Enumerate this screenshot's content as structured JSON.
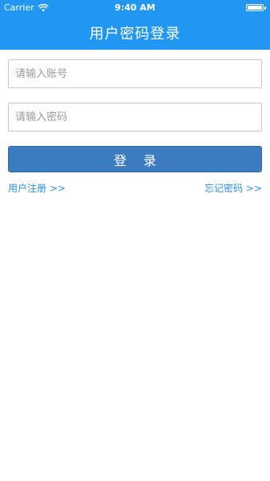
{
  "status_bar": {
    "carrier": "Carrier",
    "time": "9:40 AM",
    "battery_level": 1.0
  },
  "header": {
    "title": "用户密码登录"
  },
  "form": {
    "account_placeholder": "请输入账号",
    "account_value": "",
    "password_placeholder": "请输入密码",
    "password_value": "",
    "login_label": "登 录"
  },
  "links": {
    "register": "用户注册 >>",
    "forgot_password": "忘记密码 >>"
  },
  "colors": {
    "header_bg": "#2196f3",
    "button_bg": "#3a7cbf",
    "link": "#2a8ee8"
  },
  "icons": [
    "wifi-icon",
    "battery-icon"
  ]
}
